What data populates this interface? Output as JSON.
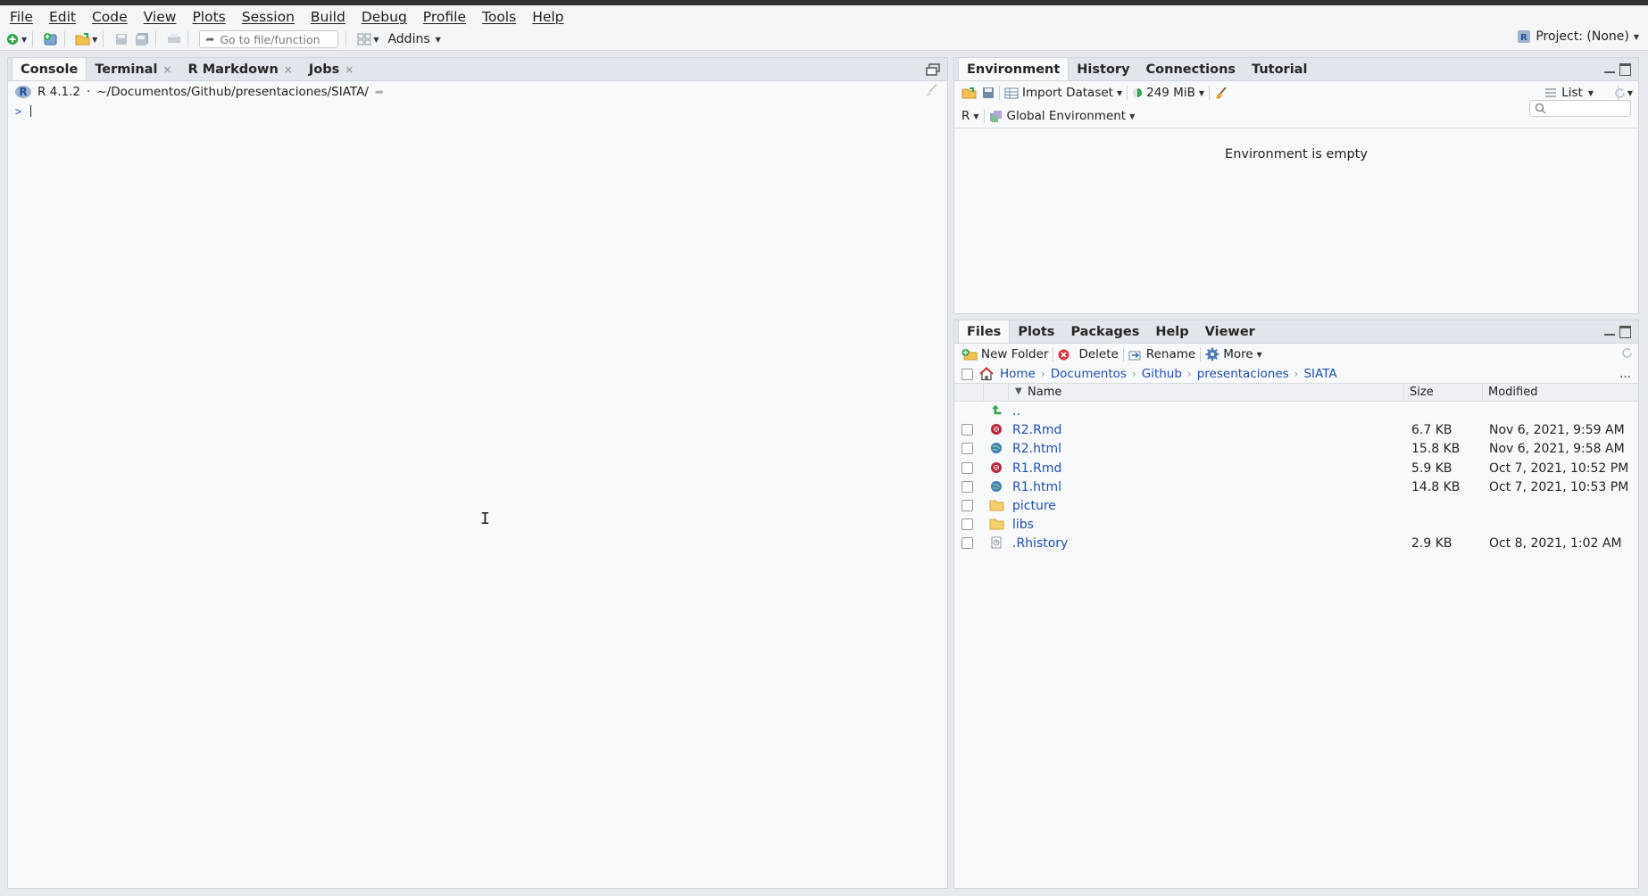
{
  "menu": [
    "File",
    "Edit",
    "Code",
    "View",
    "Plots",
    "Session",
    "Build",
    "Debug",
    "Profile",
    "Tools",
    "Help"
  ],
  "toolbar": {
    "goto_placeholder": "Go to file/function",
    "addins": "Addins",
    "project": "Project: (None)"
  },
  "left_pane": {
    "tabs": [
      "Console",
      "Terminal",
      "R Markdown",
      "Jobs"
    ],
    "r_version": "R 4.1.2",
    "dot": "·",
    "path": "~/Documentos/Github/presentaciones/SIATA/",
    "prompt": ">"
  },
  "env_pane": {
    "tabs": [
      "Environment",
      "History",
      "Connections",
      "Tutorial"
    ],
    "import_dataset": "Import Dataset",
    "memory": "249 MiB",
    "view_mode": "List",
    "language": "R",
    "scope": "Global Environment",
    "empty_message": "Environment is empty"
  },
  "files_pane": {
    "tabs": [
      "Files",
      "Plots",
      "Packages",
      "Help",
      "Viewer"
    ],
    "new_folder": "New Folder",
    "delete": "Delete",
    "rename": "Rename",
    "more": "More",
    "breadcrumbs": [
      "Home",
      "Documentos",
      "Github",
      "presentaciones",
      "SIATA"
    ],
    "ellipsis": "...",
    "columns": {
      "name": "Name",
      "size": "Size",
      "modified": "Modified"
    },
    "parent_dir": "..",
    "files": [
      {
        "name": "R2.Rmd",
        "size": "6.7 KB",
        "modified": "Nov 6, 2021, 9:59 AM",
        "icon": "rmd-icon"
      },
      {
        "name": "R2.html",
        "size": "15.8 KB",
        "modified": "Nov 6, 2021, 9:58 AM",
        "icon": "html-icon"
      },
      {
        "name": "R1.Rmd",
        "size": "5.9 KB",
        "modified": "Oct 7, 2021, 10:52 PM",
        "icon": "rmd-icon"
      },
      {
        "name": "R1.html",
        "size": "14.8 KB",
        "modified": "Oct 7, 2021, 10:53 PM",
        "icon": "html-icon"
      },
      {
        "name": "picture",
        "size": "",
        "modified": "",
        "icon": "folder-icon"
      },
      {
        "name": "libs",
        "size": "",
        "modified": "",
        "icon": "folder-icon"
      },
      {
        "name": ".Rhistory",
        "size": "2.9 KB",
        "modified": "Oct 8, 2021, 1:02 AM",
        "icon": "rhistory-icon"
      }
    ]
  }
}
